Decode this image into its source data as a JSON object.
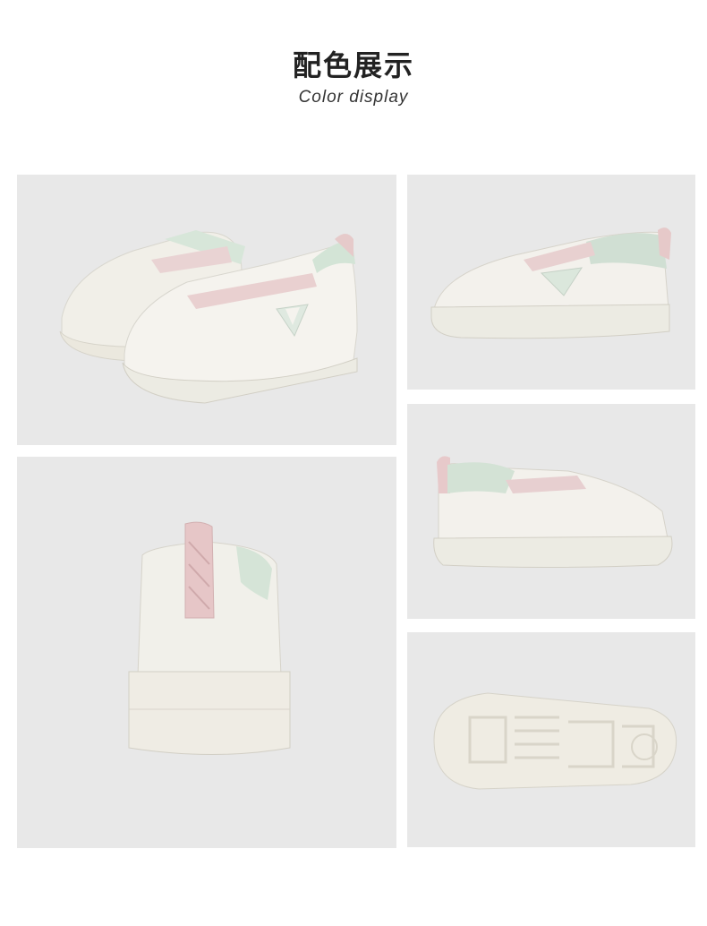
{
  "header": {
    "title_zh": "配色展示",
    "title_en": "Color display"
  },
  "colors": {
    "panel_bg": "#e8e8e8",
    "shoe_white": "#f3f1ec",
    "sole": "#ece9e1",
    "mint": "#cfe0d2",
    "pink": "#e5c8c8"
  },
  "photos": [
    {
      "name": "pair-three-quarter-view"
    },
    {
      "name": "side-view-right"
    },
    {
      "name": "heel-back-view"
    },
    {
      "name": "side-view-left"
    },
    {
      "name": "outsole-view"
    }
  ]
}
